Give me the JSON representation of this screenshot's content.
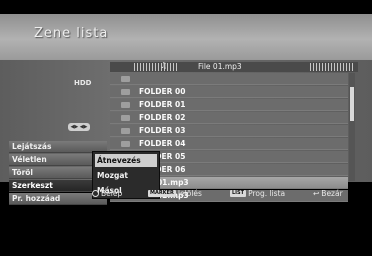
{
  "window": {
    "title": "Zene lista"
  },
  "device": {
    "source": "HDD"
  },
  "header": {
    "current_file": "File 01.mp3"
  },
  "files": [
    {
      "type": "up",
      "name": ""
    },
    {
      "type": "folder",
      "name": "FOLDER 00"
    },
    {
      "type": "folder",
      "name": "FOLDER 01"
    },
    {
      "type": "folder",
      "name": "FOLDER 02"
    },
    {
      "type": "folder",
      "name": "FOLDER 03"
    },
    {
      "type": "folder",
      "name": "FOLDER 04"
    },
    {
      "type": "folder",
      "name": "FOLDER 05"
    },
    {
      "type": "folder",
      "name": "FOLDER 06"
    },
    {
      "type": "file",
      "name": "File 01.mp3",
      "selected": true
    },
    {
      "type": "file",
      "name": "File 02.mp3"
    }
  ],
  "menu": {
    "items": [
      "Lejátszás",
      "Véletlen",
      "Töröl",
      "Szerkeszt",
      "Pr. hozzáad"
    ],
    "active": "Szerkeszt"
  },
  "popup": {
    "items": [
      "Átnevezés",
      "Mozgat",
      "Másol"
    ],
    "highlighted": "Átnevezés"
  },
  "footer": {
    "enter": "Belép",
    "marker_key": "MARKER",
    "marker_label": "Jelölés",
    "list_key": "LIST",
    "list_label": "Prog. lista",
    "close_label": "Bezár"
  },
  "colors": {
    "panel": "#6c6c6c",
    "selected_row": "#a7a7a7",
    "highlight": "#cfcfcf",
    "popup": "#2b2b2b"
  }
}
